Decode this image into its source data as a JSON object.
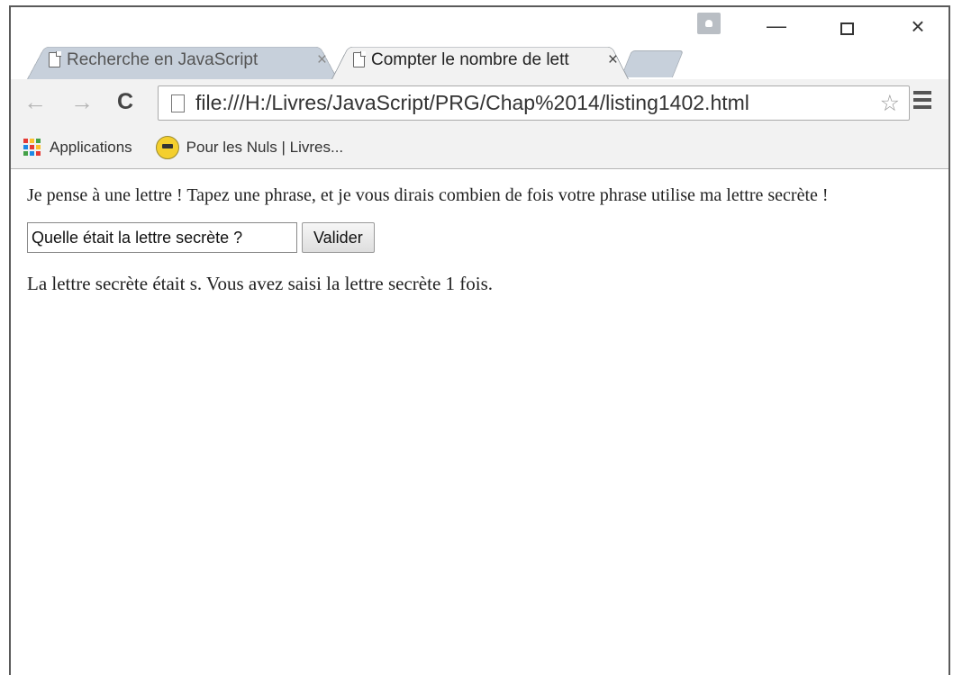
{
  "browser": {
    "tabs": [
      {
        "label": "Recherche en JavaScript",
        "active": false
      },
      {
        "label": "Compter le nombre de lett",
        "active": true
      }
    ],
    "close_glyph": "×",
    "window_controls": {
      "minimize": "—",
      "close": "×"
    },
    "toolbar": {
      "back_glyph": "←",
      "forward_glyph": "→",
      "reload_glyph": "C",
      "url": "file:///H:/Livres/JavaScript/PRG/Chap%2014/listing1402.html",
      "star_glyph": "☆"
    },
    "bookmarks": [
      {
        "label": "Applications",
        "icon": "apps-grid-icon"
      },
      {
        "label": "Pour les Nuls | Livres...",
        "icon": "pour-les-nuls-icon"
      }
    ]
  },
  "page": {
    "intro": "Je pense à une lettre ! Tapez une phrase, et je vous dirais combien de fois votre phrase utilise ma lettre secrète !",
    "input_placeholder": "Quelle était la lettre secrète ?",
    "submit_label": "Valider",
    "result": "La lettre secrète était s. Vous avez saisi la lettre secrète 1 fois."
  },
  "colors": {
    "chrome_bg": "#f2f2f2",
    "inactive_tab": "#c7d0db",
    "apps_icon": [
      "#e53935",
      "#fbc02d",
      "#43a047",
      "#1e88e5",
      "#e53935",
      "#fbc02d",
      "#43a047",
      "#1e88e5",
      "#e53935"
    ]
  }
}
